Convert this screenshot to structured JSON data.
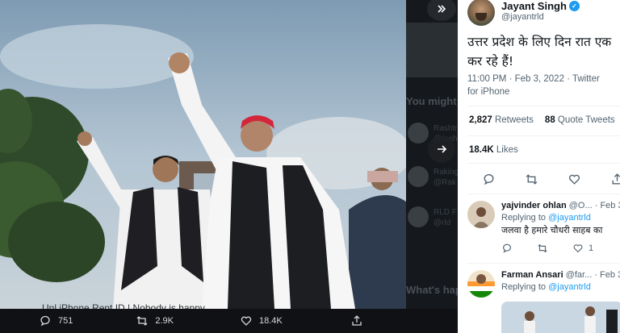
{
  "photo": {
    "scene": "rally-photo"
  },
  "background_ghost": {
    "you_might": "You might",
    "whats_happening": "What's happ",
    "caption": "Unl iPhone Rent ID | Nobody is happy..",
    "sidebar_lines": [
      "Rashtri",
      "@rashtr",
      "Raking",
      "@Rak",
      "RLD F",
      "@rld"
    ]
  },
  "media_actions": {
    "reply_count": "751",
    "retweet_count": "2.9K",
    "like_count": "18.4K"
  },
  "tweet": {
    "author_name": "Jayant Singh",
    "author_handle": "@jayantrld",
    "text": "उत्तर प्रदेश के लिए दिन रात एक कर रहे हैं!",
    "timestamp": "11:00 PM · Feb 3, 2022 · ",
    "client": "Twitter for iPhone",
    "retweets_count": "2,827",
    "retweets_label": "Retweets",
    "quotes_count": "88",
    "quotes_label": "Quote Tweets",
    "likes_count": "18.4K",
    "likes_label": "Likes"
  },
  "replies": [
    {
      "name": "yajvinder ohlan",
      "handle": "@O...",
      "date": "· Feb 3",
      "replying_to_label": "Replying to",
      "replying_to": "@jayantrld",
      "text": "जलवा है हमारे चौधरी साहब का",
      "like_count": "1"
    },
    {
      "name": "Farman Ansari",
      "handle": "@far...",
      "date": "· Feb 3",
      "replying_to_label": "Replying to",
      "replying_to": "@jayantrld"
    }
  ],
  "colors": {
    "accent": "#1d9bf0",
    "panel_bg": "#ffffff",
    "actionbar_bg": "#0f1114"
  }
}
